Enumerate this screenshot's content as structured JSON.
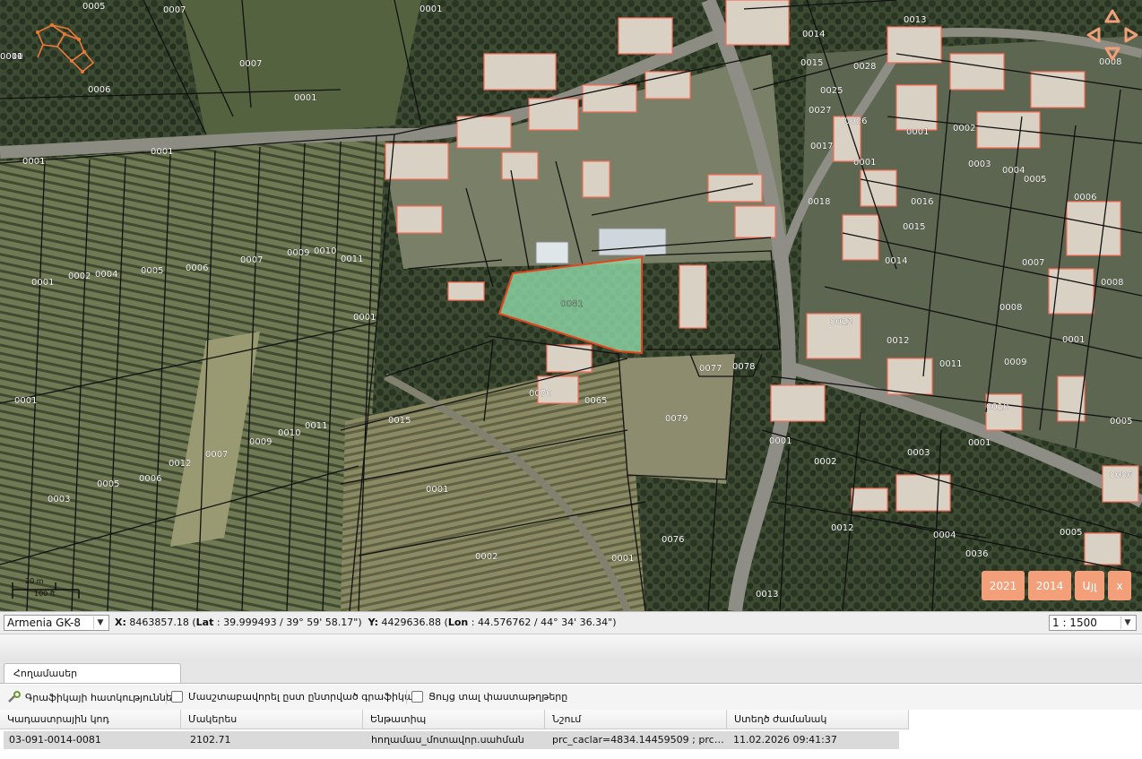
{
  "map": {
    "parcel_labels": [
      "0005",
      "0007",
      "0001",
      "0006",
      "0007",
      "0003",
      "0004",
      "0005",
      "0008",
      "0001",
      "0005",
      "0002",
      "0001",
      "0003",
      "0001",
      "0001",
      "0009",
      "0010",
      "0008",
      "0006",
      "0007",
      "0005",
      "0004",
      "0003",
      "0006",
      "0011",
      "0012",
      "0002",
      "0080",
      "0001",
      "0006",
      "0066",
      "0001",
      "0001",
      "0002",
      "0003",
      "0005",
      "0006",
      "0007",
      "0009",
      "0010",
      "0011",
      "0001",
      "0070",
      "0065",
      "0077",
      "0078",
      "0079",
      "0015",
      "0001",
      "0002",
      "0001",
      "0076",
      "0003",
      "0002",
      "0005",
      "0006",
      "0007",
      "0012",
      "0009",
      "0010",
      "0011",
      "0013",
      "0014",
      "0015",
      "0028",
      "0025",
      "0027",
      "0026",
      "0017",
      "0001",
      "0018",
      "0013",
      "0012",
      "0011",
      "0010",
      "0009",
      "0001",
      "0002",
      "0003",
      "0004",
      "0005",
      "0006",
      "0016",
      "0015",
      "0014",
      "0007",
      "0008",
      "0008",
      "0013",
      "0012",
      "0011",
      "0009",
      "0001",
      "0010",
      "0001",
      "0002",
      "0003",
      "0001",
      "0012",
      "0004",
      "0005",
      "0006",
      "0005",
      "0036",
      "0013",
      "0001",
      "0008",
      "0001",
      "0001"
    ],
    "selected_parcel_label": "0081",
    "selected_fill": "#8fd9a8",
    "selected_stroke": "#e8431c"
  },
  "scale_bar": {
    "top_label": "20 m",
    "bottom_label": "100 ft"
  },
  "year_buttons": [
    {
      "label": "2021"
    },
    {
      "label": "2014"
    },
    {
      "label": "Այլ"
    },
    {
      "label": "x"
    }
  ],
  "status": {
    "projection": "Armenia GK-8",
    "x_label": "X:",
    "x_value": "8463857.18",
    "lat_label": "Lat",
    "lat_value": "39.999493 / 39° 59' 58.17\"",
    "y_label": "Y:",
    "y_value": "4429636.88",
    "lon_label": "Lon",
    "lon_value": "44.576762 / 44° 34' 36.34\"",
    "scale": "1 : 1500"
  },
  "tabs": {
    "active": "Հողամասեր"
  },
  "toolbar": {
    "graphics_props": "Գրաֆիկայի հատկություններ",
    "zoom_selected": "Մասշտաբավորել ըստ ընտրված գրաֆիկայի",
    "show_docs": "Ցույց տալ փաստաթղթերը"
  },
  "table": {
    "columns": [
      "Կադաստրային կոդ",
      "Մակերես",
      "Ենթատիպ",
      "Նշում",
      "Ստեղծ ժամանակ"
    ],
    "rows": [
      [
        "03-091-0014-0081",
        "2102.71",
        "հողամաս_մոտավոր.սահման",
        "prc_caclar=4834.14459509 ; prc_per...",
        "11.02.2026 09:41:37"
      ]
    ]
  },
  "colors": {
    "accent": "#f3a07a",
    "parcel_border": "#111111",
    "building_border": "#ff6a55"
  }
}
